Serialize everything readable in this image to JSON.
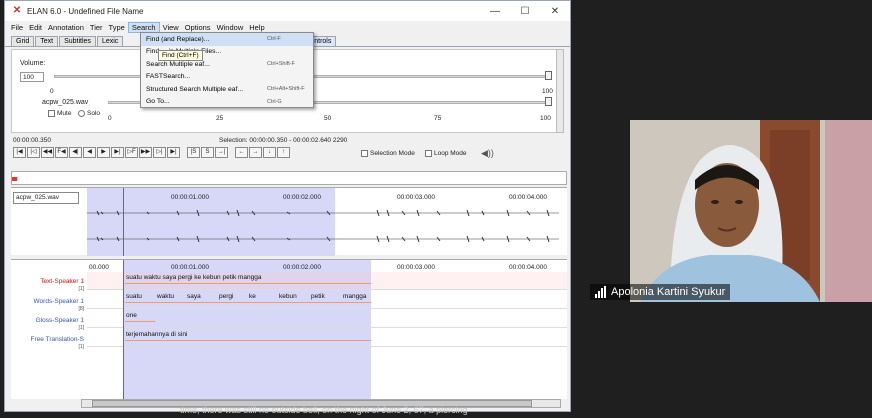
{
  "window": {
    "title": "ELAN 6.0 - Undefined File Name",
    "min": "—",
    "max": "☐",
    "close": "✕"
  },
  "menu": [
    "File",
    "Edit",
    "Annotation",
    "Tier",
    "Type",
    "Search",
    "View",
    "Options",
    "Window",
    "Help"
  ],
  "tabs": [
    "Grid",
    "Text",
    "Subtitles",
    "Lexic",
    "Controls"
  ],
  "media": {
    "volume_label": "Volume:",
    "volume_value": "100",
    "scale_min": "0",
    "scale_max": "100",
    "file": "acpw_025.wav",
    "mute": "Mute",
    "solo": "Solo",
    "ticks": [
      "0",
      "25",
      "50",
      "75",
      "100"
    ]
  },
  "controls": {
    "time": "00:00:00.350",
    "selection": "Selection: 00:00:00.350 - 00:00:02.640  2290",
    "selection_mode": "Selection Mode",
    "loop_mode": "Loop Mode",
    "buttons1": [
      "|◀",
      "|◁",
      "◀◀",
      "F◀",
      "◀|",
      "◀",
      "▶",
      "▶|",
      "▷F",
      "▶▶",
      "▷|",
      "▶|"
    ],
    "buttons2": [
      "|S",
      "S",
      "→|"
    ],
    "buttons3": [
      "←",
      "→",
      "↓",
      "↑"
    ]
  },
  "wave": {
    "file_select": "acpw_025.wav",
    "times": [
      "00:00:01.000",
      "00:00:02.000",
      "00:00:03.000",
      "00:00:04.000"
    ]
  },
  "annotation": {
    "left_time": "00.000",
    "times": [
      "00:00:01.000",
      "00:00:02.000",
      "00:00:03.000",
      "00:00:04.000"
    ],
    "tiers": [
      {
        "name": "Text-Speaker 1",
        "count": "[1]"
      },
      {
        "name": "Words-Speaker 1",
        "count": "[8]"
      },
      {
        "name": "Gloss-Speaker 1",
        "count": "[1]"
      },
      {
        "name": "Free Translation-S",
        "count": "[1]"
      }
    ],
    "text": "suatu waktu saya pergi ke kebun petik mangga",
    "words": [
      "suatu",
      "waktu",
      "saya",
      "pergi",
      "ke",
      "kebun",
      "petik",
      "mangga"
    ],
    "gloss": "one",
    "translation": "terjemahannya di sini"
  },
  "search_menu": {
    "items": [
      {
        "label": "Find (and Replace)...",
        "shortcut": "Ctrl-F"
      },
      {
        "label": "Find ... in Multiple Files...",
        "shortcut": ""
      },
      {
        "label": "Search Multiple eaf...",
        "shortcut": "Ctrl+Shift-F"
      },
      {
        "label": "FASTSearch...",
        "shortcut": ""
      },
      {
        "label": "Structured Search Multiple eaf...",
        "shortcut": "Ctrl+Alt+Shift-F"
      },
      {
        "label": "Go To...",
        "shortcut": "Ctrl-G"
      }
    ],
    "tooltip": "Find (Ctrl+F)"
  },
  "video": {
    "participant": "Apolonia Kartini Syukur"
  },
  "bottom_text": "time, there was still no outside bell, on the night of June 2, 67, a piercing"
}
